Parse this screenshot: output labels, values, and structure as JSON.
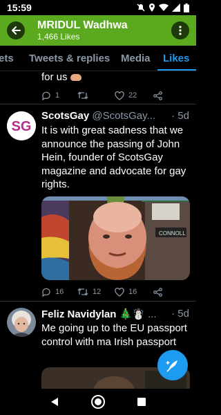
{
  "status": {
    "time": "15:59"
  },
  "header": {
    "title": "MRIDUL Wadhwa",
    "subtitle": "1,466 Likes"
  },
  "tabs": [
    {
      "label": "ets"
    },
    {
      "label": "Tweets & replies"
    },
    {
      "label": "Media"
    },
    {
      "label": "Likes",
      "active": true
    }
  ],
  "prev_tweet": {
    "text": "for us",
    "reply": "1",
    "retweet": "",
    "like": "22"
  },
  "tweet1": {
    "avatar_text": "SG",
    "name": "ScotsGay",
    "handle": "@ScotsGay...",
    "time": "· 5d",
    "text": "It is with great sadness that we announce the passing of John Hein, founder of ScotsGay magazine and advocate for gay rights.",
    "sign_text": "CONNOLL",
    "reply": "16",
    "retweet": "12",
    "like": "16"
  },
  "tweet2": {
    "name": "Feliz Navidylan 🎄☃️",
    "handle": "...",
    "time": "· 5d",
    "text": "Me going up to the EU passport control with ma Irish passport"
  },
  "colors": {
    "accent": "#1d9bf0",
    "header": "#5aa91e",
    "muted": "#8b98a5"
  }
}
